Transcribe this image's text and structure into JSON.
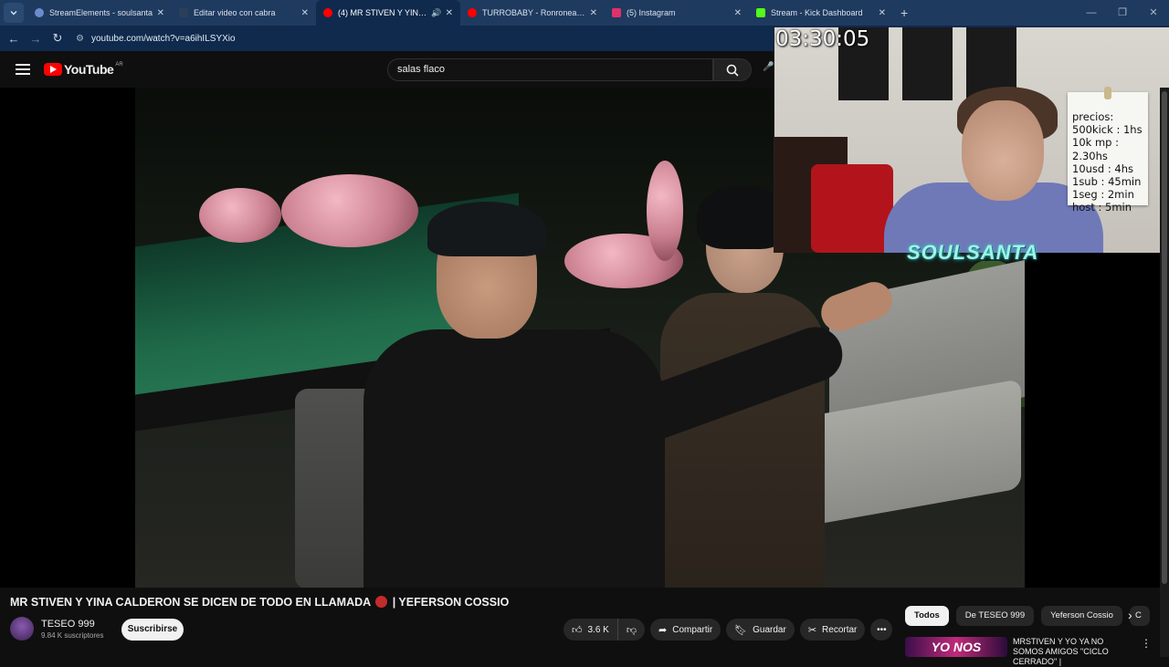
{
  "browser": {
    "tabs": [
      {
        "label": "StreamElements - soulsanta",
        "color": "#6b8ccc"
      },
      {
        "label": "Editar video con cabra",
        "color": "#2b3f5a"
      },
      {
        "label": "(4) MR STIVEN Y YINA CALI",
        "color": "#ff0000",
        "active": true
      },
      {
        "label": "TURROBABY - Ronronea (prod.",
        "color": "#ff0000"
      },
      {
        "label": "(5) Instagram",
        "color": "#e1306c"
      },
      {
        "label": "Stream - Kick Dashboard",
        "color": "#53fc18"
      }
    ],
    "url": "youtube.com/watch?v=a6ihILSYXio"
  },
  "youtube": {
    "logo_text": "YouTube",
    "region": "AR",
    "search_value": "salas flaco"
  },
  "overlay": {
    "timer": "03:30:05",
    "prices": [
      "precios:",
      "500kick : 1hs",
      "10k mp : 2.30hs",
      "10usd : 4hs",
      "1sub : 45min",
      "1seg : 2min",
      "host : 5min"
    ],
    "brand": "SOULSANTA"
  },
  "video": {
    "title_main": "MR STIVEN Y YINA CALDERON SE DICEN DE TODO EN LLAMADA",
    "title_tail": "| YEFERSON COSSIO",
    "channel": "TESEO 999",
    "subscribers": "9.84 K suscriptores",
    "subscribe_label": "Suscribirse",
    "likes": "3.6 K",
    "share_label": "Compartir",
    "save_label": "Guardar",
    "clip_label": "Recortar"
  },
  "sidebar": {
    "chips": [
      "Todos",
      "De TESEO 999",
      "Yeferson Cossio",
      "C"
    ],
    "rec_thumb_text": "YO NOS",
    "rec_title": "MRSTIVEN Y YO YA NO SOMOS AMIGOS \"CICLO CERRADO\" |"
  }
}
